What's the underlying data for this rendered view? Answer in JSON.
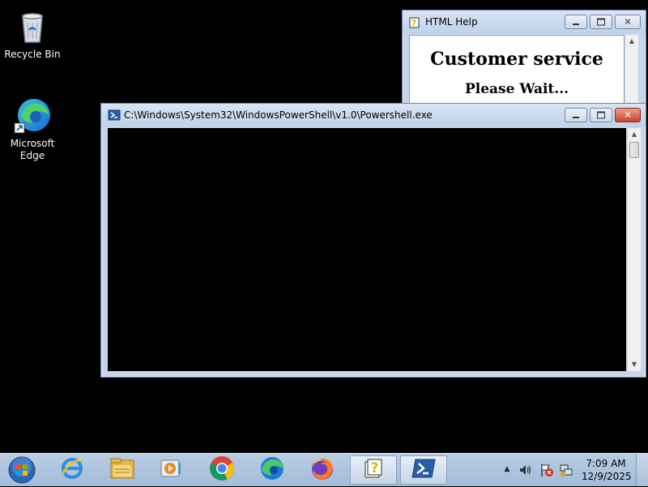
{
  "desktop": {
    "icons": [
      {
        "label": "Recycle Bin",
        "icon": "recycle-bin-icon"
      },
      {
        "label": "Microsoft\nEdge",
        "label_line1": "Microsoft",
        "label_line2": "Edge",
        "icon": "edge-icon"
      }
    ]
  },
  "html_help": {
    "title": "HTML Help",
    "heading": "Customer service",
    "message": "Please Wait..."
  },
  "powershell": {
    "title": "C:\\Windows\\System32\\WindowsPowerShell\\v1.0\\Powershell.exe"
  },
  "taskbar": {
    "items": [
      {
        "icon": "start-orb-icon"
      },
      {
        "icon": "internet-explorer-icon"
      },
      {
        "icon": "file-explorer-icon"
      },
      {
        "icon": "media-player-icon"
      },
      {
        "icon": "chrome-icon"
      },
      {
        "icon": "edge-icon"
      },
      {
        "icon": "firefox-icon"
      },
      {
        "icon": "html-help-icon",
        "active": true
      },
      {
        "icon": "powershell-icon",
        "active": true
      }
    ],
    "clock": {
      "time": "7:09 AM",
      "date": "12/9/2025"
    }
  },
  "colors": {
    "desktop": "#000000",
    "console_bg": "#000000",
    "taskbar": "#a3bcd8",
    "close_button": "#c8452c"
  }
}
